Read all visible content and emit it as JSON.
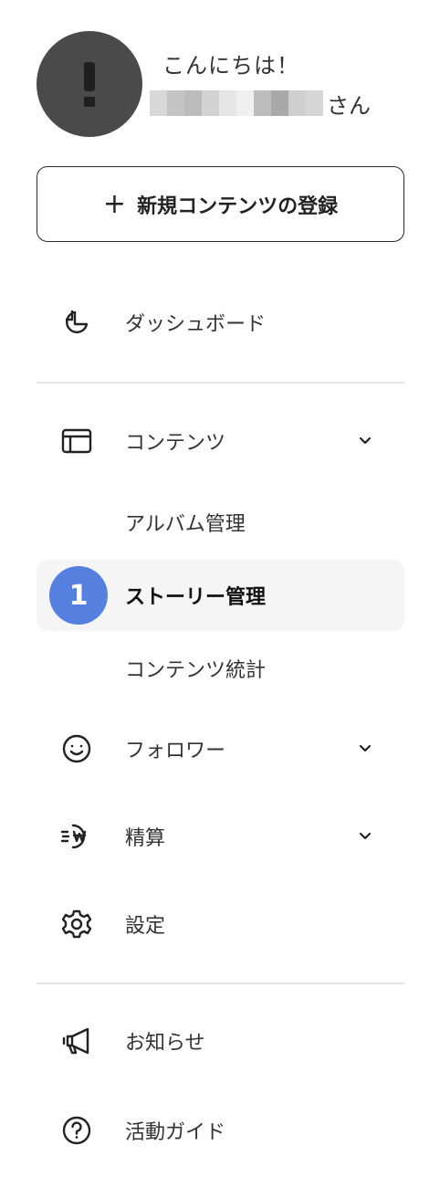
{
  "profile": {
    "greeting": "こんにちは！",
    "name_suffix": "さん",
    "redacted_colors": [
      "#d8d8d8",
      "#c4c4c4",
      "#bbbbbb",
      "#d2d2d2",
      "#e6e6e6",
      "#f0f0f0",
      "#bdbdbd",
      "#a9a9a9",
      "#cfcfcf",
      "#d6d6d6"
    ]
  },
  "new_content_button": {
    "icon": "plus-icon",
    "label": "新規コンテンツの登録"
  },
  "nav": {
    "dashboard": {
      "label": "ダッシュボード",
      "icon": "pie-chart-icon"
    },
    "contents": {
      "label": "コンテンツ",
      "icon": "layout-icon",
      "expanded": true,
      "children": [
        {
          "label": "アルバム管理",
          "active": false
        },
        {
          "label": "ストーリー管理",
          "active": true,
          "badge": "1"
        },
        {
          "label": "コンテンツ統計",
          "active": false
        }
      ]
    },
    "followers": {
      "label": "フォロワー",
      "icon": "smile-icon"
    },
    "settlement": {
      "label": "精算",
      "icon": "won-coin-icon"
    },
    "settings": {
      "label": "設定",
      "icon": "gear-icon"
    },
    "notices": {
      "label": "お知らせ",
      "icon": "megaphone-icon"
    },
    "guide": {
      "label": "活動ガイド",
      "icon": "help-circle-icon"
    }
  },
  "colors": {
    "accent_badge": "#5580e0",
    "active_background": "#f5f5f5",
    "divider": "#e4e4e4",
    "avatar": "#4a4a4a"
  }
}
